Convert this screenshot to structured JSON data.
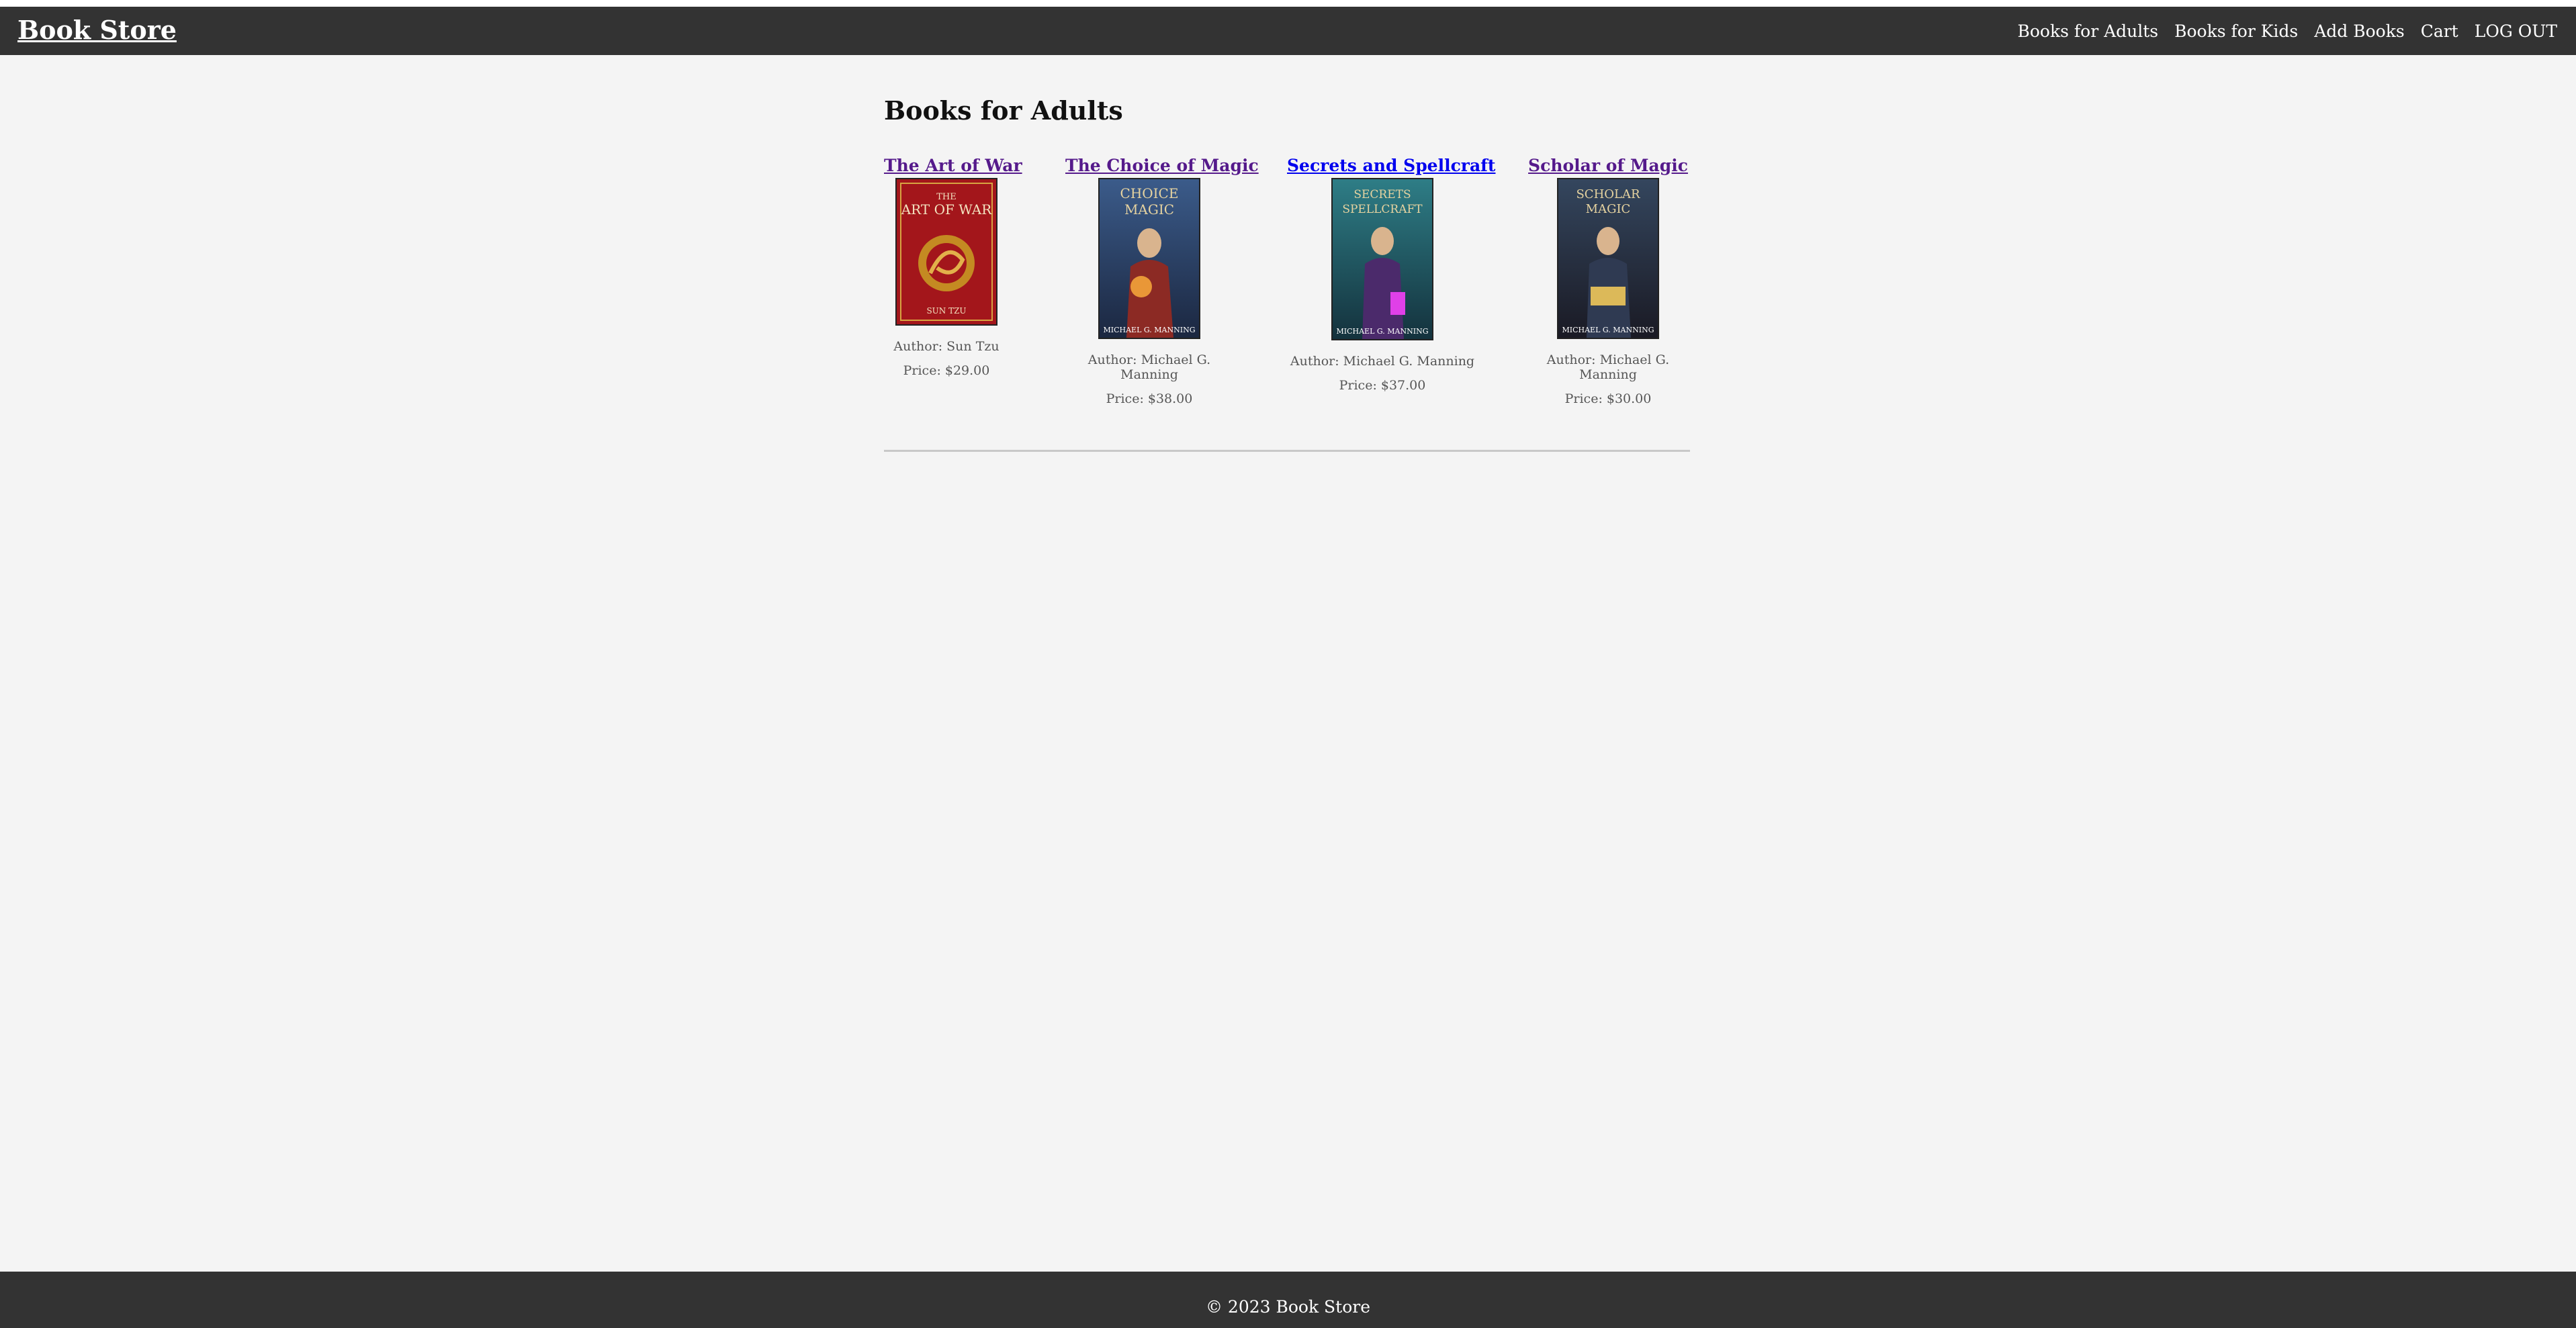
{
  "header": {
    "brand": "Book Store",
    "nav": [
      "Books for Adults",
      "Books for Kids",
      "Add Books",
      "Cart",
      "LOG OUT"
    ]
  },
  "main": {
    "heading": "Books for Adults",
    "books": [
      {
        "title": "The Art of War",
        "author": "Author: Sun Tzu",
        "price": "Price: $29.00",
        "cover_text": [
          "THE",
          "ART OF WAR",
          "SUN TZU"
        ]
      },
      {
        "title": "The Choice of Magic",
        "author": "Author: Michael G. Manning",
        "price": "Price: $38.00",
        "cover_text": [
          "CHOICE",
          "MAGIC",
          "MICHAEL G. MANNING"
        ]
      },
      {
        "title": "Secrets and Spellcraft",
        "author": "Author: Michael G. Manning",
        "price": "Price: $37.00",
        "cover_text": [
          "SECRETS",
          "SPELLCRAFT",
          "MICHAEL G. MANNING"
        ]
      },
      {
        "title": "Scholar of Magic",
        "author": "Author: Michael G. Manning",
        "price": "Price: $30.00",
        "cover_text": [
          "SCHOLAR",
          "MAGIC",
          "MICHAEL G. MANNING"
        ]
      }
    ]
  },
  "footer": {
    "text": "© 2023 Book Store"
  },
  "colors": {
    "bar": "#333333",
    "background": "#f4f4f4",
    "visited_link": "#551a8b",
    "link": "#0000ee"
  }
}
